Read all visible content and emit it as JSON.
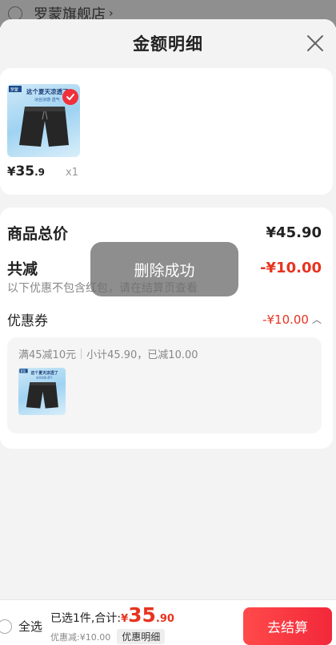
{
  "background": {
    "store_name": "罗蒙旗舰店",
    "chevron": "›"
  },
  "sheet": {
    "title": "金额明细"
  },
  "item": {
    "price_yen": "¥",
    "price_int": "35",
    "price_dec": ".9",
    "qty": "x1",
    "thumb_brand": "罗蒙",
    "thumb_caption": "这个夏天凉透了",
    "thumb_sub": "冰丝凉感 透气"
  },
  "summary": {
    "total_label": "商品总价",
    "total_value": "¥45.90",
    "reduce_label": "共减",
    "reduce_value": "-¥10.00",
    "hint": "以下优惠不包含红包，请在结算页查看",
    "coupon_label": "优惠券",
    "coupon_value": "-¥10.00",
    "coupon_arrow": "︿",
    "coupon_rule": "满45减10元",
    "coupon_detail": "小计45.90，已减10.00"
  },
  "toast": {
    "text": "删除成功"
  },
  "bottom": {
    "select_all": "全选",
    "selected_total_label": "已选1件,合计:",
    "total_yen": "¥",
    "total_int": "35",
    "total_dec": ".90",
    "discount_text": "优惠减:¥10.00",
    "detail_button": "优惠明细",
    "checkout": "去结算"
  },
  "colors": {
    "accent_red": "#e8331f",
    "checkout_red": "#f2283a"
  },
  "icons": {
    "close": "close-icon",
    "check": "check-icon",
    "radio": "radio-icon"
  }
}
